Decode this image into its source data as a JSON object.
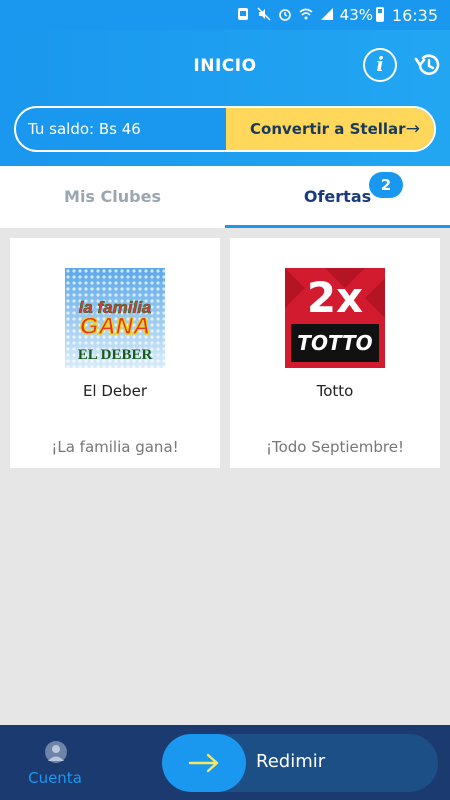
{
  "status_bar": {
    "battery": "43%",
    "time": "16:35"
  },
  "header": {
    "title": "INICIO"
  },
  "balance": {
    "label": "Tu saldo:  Bs 46",
    "convert_label": "Convertir a Stellar",
    "arrow": "→"
  },
  "tabs": [
    {
      "label": "Mis Clubes",
      "active": false
    },
    {
      "label": "Ofertas",
      "active": true,
      "badge": "2"
    }
  ],
  "offers": [
    {
      "name": "El Deber",
      "description": "¡La familia gana!",
      "logo_line1": "la familia",
      "logo_line2": "GANA",
      "logo_line3": "EL DEBER"
    },
    {
      "name": "Totto",
      "description": "¡Todo Septiembre!",
      "logo_line1": "2x",
      "logo_line2": "TOTTO"
    }
  ],
  "bottom_nav": {
    "account_label": "Cuenta",
    "redeem_label": "Redimir"
  },
  "colors": {
    "primary": "#1a97ee",
    "accent": "#ffd75a",
    "navy": "#1b3b70"
  }
}
